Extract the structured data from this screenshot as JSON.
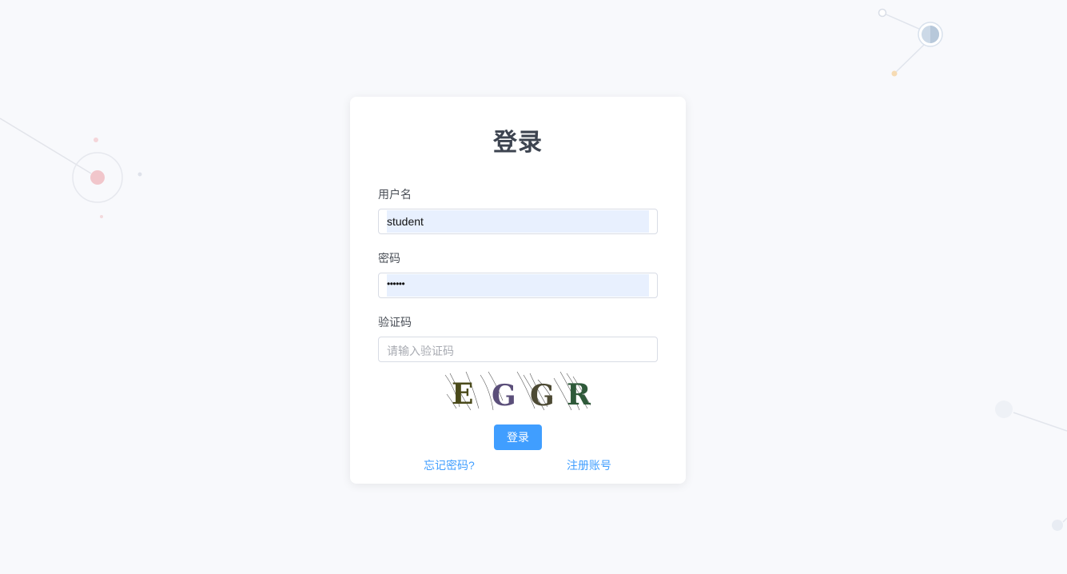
{
  "login": {
    "title": "登录",
    "username": {
      "label": "用户名",
      "value": "student"
    },
    "password": {
      "label": "密码",
      "value": "••••••"
    },
    "captcha": {
      "label": "验证码",
      "placeholder": "请输入验证码",
      "image_text": [
        "E",
        "G",
        "G",
        "R"
      ]
    },
    "submit_label": "登录",
    "forgot_label": "忘记密码?",
    "register_label": "注册账号"
  },
  "colors": {
    "primary": "#409eff",
    "background": "#f8f9fc",
    "autofill": "#e8f0fe",
    "title": "#3d4450"
  }
}
